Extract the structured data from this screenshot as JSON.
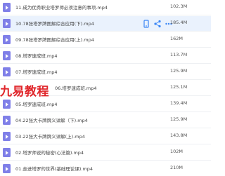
{
  "files": [
    {
      "name": "11.成为优秀职业塔罗师必须注意的事项.mp4",
      "size": "102.3M"
    },
    {
      "name": "10.78张塔罗牌图解综合应用(下).mp4",
      "size": "185.4M"
    },
    {
      "name": "09.78张塔罗牌图解综合应用(上).mp4",
      "size": "162M"
    },
    {
      "name": "08.塔罗速成班.mp4",
      "size": "113.7M"
    },
    {
      "name": "07.塔罗速成班.mp4",
      "size": "125.9M"
    },
    {
      "name": "06.塔罗速成班.mp4",
      "size": "125.1M"
    },
    {
      "name": "05.塔罗速成班.mp4",
      "size": "139.4M"
    },
    {
      "name": "04.22张大卡牌牌义详解（下).mp4",
      "size": "125.9M"
    },
    {
      "name": "03.22张大卡牌牌义详解(上).mp4",
      "size": "143.8M"
    },
    {
      "name": "02.塔罗师说的秘密(心法篇).mp4",
      "size": "102M"
    },
    {
      "name": "01.走进塔罗的世界(基础理论课).mp4",
      "size": "210M"
    }
  ],
  "row_actions": [
    {
      "icon": "mobile-icon",
      "label": ""
    },
    {
      "icon": "share-icon",
      "label": ""
    },
    {
      "icon": "more-icon",
      "label": ""
    }
  ],
  "watermark": {
    "text": "九易教程"
  },
  "colors": {
    "file_icon": "#7f7fe8",
    "selected_row": "#eaf2fd",
    "action_icon": "#3a86f5",
    "watermark": "#e0262b"
  }
}
